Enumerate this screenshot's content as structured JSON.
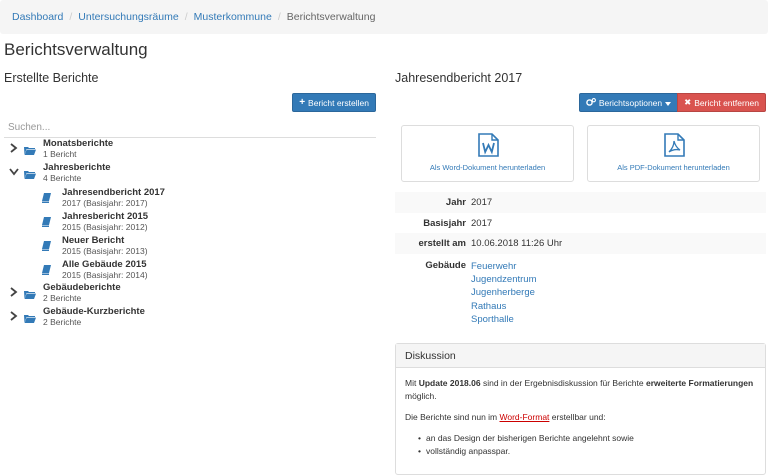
{
  "breadcrumb": {
    "items": [
      "Dashboard",
      "Untersuchungsräume",
      "Musterkommune"
    ],
    "active": "Berichtsverwaltung"
  },
  "page_title": "Berichtsverwaltung",
  "left": {
    "heading": "Erstellte Berichte",
    "create_button": "Bericht erstellen",
    "search_placeholder": "Suchen...",
    "tree": [
      {
        "name": "Monatsberichte",
        "count": "1 Bericht",
        "expanded": false
      },
      {
        "name": "Jahresberichte",
        "count": "4 Berichte",
        "expanded": true,
        "children": [
          {
            "name": "Jahresendbericht 2017",
            "sub": "2017 (Basisjahr: 2017)"
          },
          {
            "name": "Jahresbericht 2015",
            "sub": "2015 (Basisjahr: 2012)"
          },
          {
            "name": "Neuer Bericht",
            "sub": "2015 (Basisjahr: 2013)"
          },
          {
            "name": "Alle Gebäude 2015",
            "sub": "2015 (Basisjahr: 2014)"
          }
        ]
      },
      {
        "name": "Gebäudeberichte",
        "count": "2 Berichte",
        "expanded": false
      },
      {
        "name": "Gebäude-Kurzberichte",
        "count": "2 Berichte",
        "expanded": false
      }
    ]
  },
  "right": {
    "heading": "Jahresendbericht 2017",
    "options_button": "Berichtsoptionen",
    "delete_button": "Bericht entfernen",
    "word_download": "Als Word-Dokument herunterladen",
    "pdf_download": "Als PDF-Dokument herunterladen",
    "info": {
      "jahr_label": "Jahr",
      "jahr_value": "2017",
      "basisjahr_label": "Basisjahr",
      "basisjahr_value": "2017",
      "erstellt_label": "erstellt am",
      "erstellt_value": "10.06.2018 11:26 Uhr",
      "gebaeude_label": "Gebäude",
      "gebaeude": [
        "Feuerwehr",
        "Jugendzentrum",
        "Jugenherberge",
        "Rathaus",
        "Sporthalle"
      ]
    },
    "discussion": {
      "title": "Diskussion",
      "p1_pre": "Mit ",
      "p1_bold1": "Update 2018.06",
      "p1_mid": " sind in der Ergebnisdiskussion für Berichte ",
      "p1_bold2": "erweiterte Formatierungen",
      "p1_post": " möglich.",
      "p2_pre": "Die Berichte sind nun im ",
      "p2_link": "Word-Format",
      "p2_post": " erstellbar und:",
      "bullets": [
        "an das Design der bisherigen Berichte angelehnt sowie",
        "vollständig anpasspar."
      ]
    }
  },
  "colors": {
    "primary": "#337ab7",
    "danger": "#d9534f",
    "link": "#337ab7",
    "folder": "#337ab7"
  }
}
